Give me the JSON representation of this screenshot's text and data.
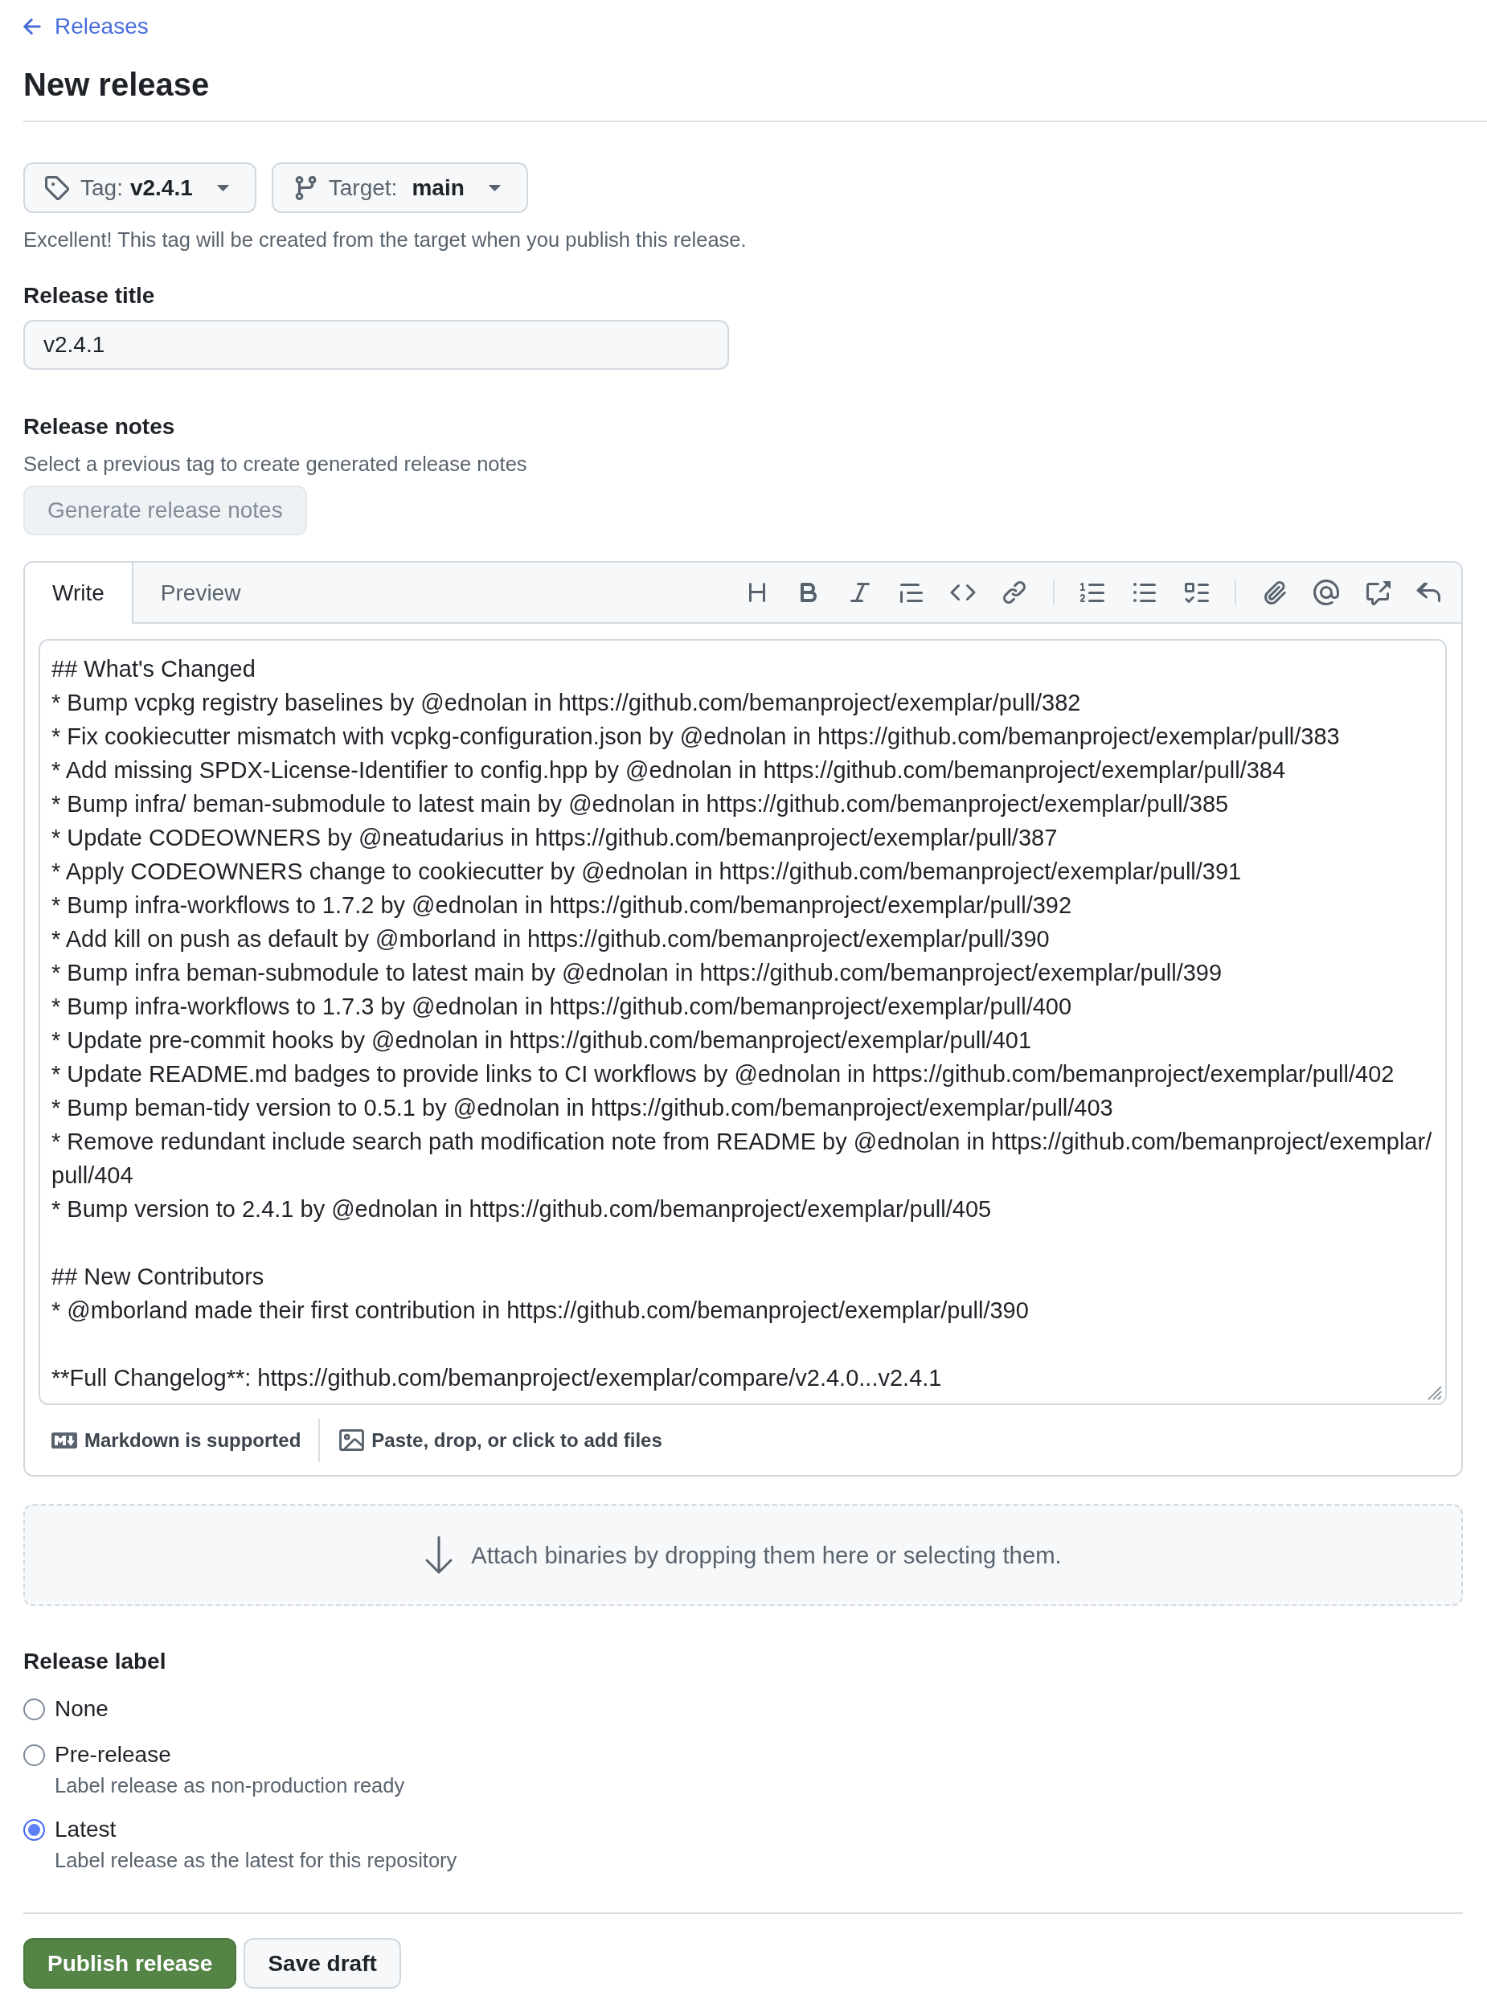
{
  "back_link": {
    "label": "Releases"
  },
  "page_title": "New release",
  "branch_pickers": [
    {
      "kind": "tag",
      "label": "Tag:",
      "value": "v2.4.1"
    },
    {
      "kind": "target",
      "label": "Target:",
      "value": "main"
    }
  ],
  "picker_note": "Excellent! This tag will be created from the target when you publish this release.",
  "release_title": {
    "label": "Release title",
    "value": "v2.4.1"
  },
  "release_notes": {
    "label": "Release notes",
    "hint": "Select a previous tag to create generated release notes",
    "generate_button": {
      "label": "Generate release notes",
      "disabled": true
    }
  },
  "editor": {
    "tabs": [
      {
        "label": "Write",
        "selected": true
      },
      {
        "label": "Preview",
        "selected": false
      }
    ],
    "paragraphs": [
      [
        "## What's Changed",
        "* Bump vcpkg registry baselines by @ednolan in https://github.com/bemanproject/exemplar/pull/382",
        "* Fix cookiecutter mismatch with vcpkg-configuration.json by @ednolan in https://github.com/bemanproject/exemplar/pull/383",
        "* Add missing SPDX-License-Identifier to config.hpp by @ednolan in https://github.com/bemanproject/exemplar/pull/384",
        "* Bump infra/ beman-submodule to latest main by @ednolan in https://github.com/bemanproject/exemplar/pull/385",
        "* Update CODEOWNERS by @neatudarius in https://github.com/bemanproject/exemplar/pull/387",
        "* Apply CODEOWNERS change to cookiecutter by @ednolan in https://github.com/bemanproject/exemplar/pull/391",
        "* Bump infra-workflows to 1.7.2 by @ednolan in https://github.com/bemanproject/exemplar/pull/392",
        "* Add kill on push as default by @mborland in https://github.com/bemanproject/exemplar/pull/390",
        "* Bump infra beman-submodule to latest main by @ednolan in https://github.com/bemanproject/exemplar/pull/399",
        "* Bump infra-workflows to 1.7.3 by @ednolan in https://github.com/bemanproject/exemplar/pull/400",
        "* Update pre-commit hooks by @ednolan in https://github.com/bemanproject/exemplar/pull/401",
        "* Update README.md badges to provide links to CI workflows by @ednolan in https://github.com/bemanproject/exemplar/pull/402",
        "* Bump beman-tidy version to 0.5.1 by @ednolan in https://github.com/bemanproject/exemplar/pull/403",
        "* Remove redundant include search path modification note from README by @ednolan in https://github.com/bemanproject/exemplar/pull/404",
        "* Bump version to 2.4.1 by @ednolan in https://github.com/bemanproject/exemplar/pull/405"
      ],
      [
        "## New Contributors",
        "* @mborland made their first contribution in https://github.com/bemanproject/exemplar/pull/390"
      ],
      [
        "**Full Changelog**: https://github.com/bemanproject/exemplar/compare/v2.4.0...v2.4.1"
      ]
    ],
    "footer": {
      "markdown_note": "Markdown is supported",
      "upload_note": "Paste, drop, or click to add files"
    }
  },
  "attach_zone": {
    "text": "Attach binaries by dropping them here or selecting them."
  },
  "release_label": {
    "title": "Release label",
    "options": [
      {
        "label": "None",
        "selected": false
      },
      {
        "label": "Pre-release",
        "description": "Label release as non-production ready",
        "selected": false
      },
      {
        "label": "Latest",
        "description": "Label release as the latest for this repository",
        "selected": true
      }
    ]
  },
  "actions": [
    {
      "label": "Publish release",
      "kind": "primary"
    },
    {
      "label": "Save draft",
      "kind": "secondary"
    }
  ]
}
